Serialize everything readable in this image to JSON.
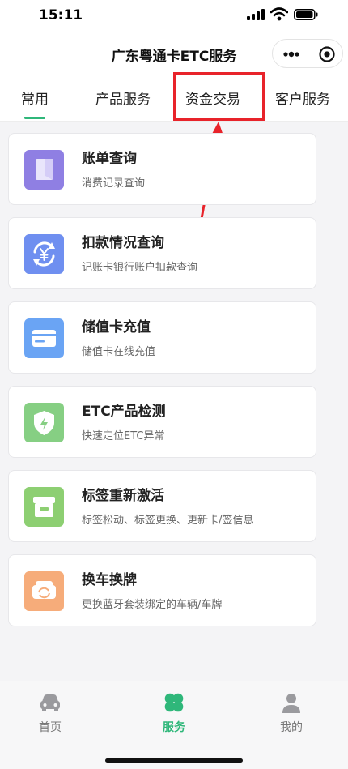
{
  "status_bar": {
    "time": "15:11"
  },
  "header": {
    "title": "广东粤通卡ETC服务"
  },
  "tabs": [
    {
      "label": "常用",
      "active": true
    },
    {
      "label": "产品服务",
      "active": false
    },
    {
      "label": "资金交易",
      "active": false,
      "highlighted": true
    },
    {
      "label": "客户服务",
      "active": false
    }
  ],
  "services": [
    {
      "title": "账单查询",
      "subtitle": "消费记录查询",
      "icon": "bill-icon",
      "color": "#8f7fe3"
    },
    {
      "title": "扣款情况查询",
      "subtitle": "记账卡银行账户扣款查询",
      "icon": "yuan-refresh-icon",
      "color": "#6f8ff0"
    },
    {
      "title": "储值卡充值",
      "subtitle": "储值卡在线充值",
      "icon": "card-icon",
      "color": "#6aa4f4"
    },
    {
      "title": "ETC产品检测",
      "subtitle": "快速定位ETC异常",
      "icon": "shield-icon",
      "color": "#86cf83"
    },
    {
      "title": "标签重新激活",
      "subtitle": "标签松动、标签更换、更新卡/签信息",
      "icon": "tag-box-icon",
      "color": "#8dcf72"
    },
    {
      "title": "换车换牌",
      "subtitle": "更换蓝牙套装绑定的车辆/车牌",
      "icon": "car-swap-icon",
      "color": "#f6ac7a"
    }
  ],
  "bottom_nav": [
    {
      "label": "首页",
      "icon": "car-icon",
      "active": false
    },
    {
      "label": "服务",
      "icon": "clover-icon",
      "active": true
    },
    {
      "label": "我的",
      "icon": "person-icon",
      "active": false
    }
  ],
  "colors": {
    "accent": "#2fb77a",
    "annotation": "#e8232a"
  }
}
